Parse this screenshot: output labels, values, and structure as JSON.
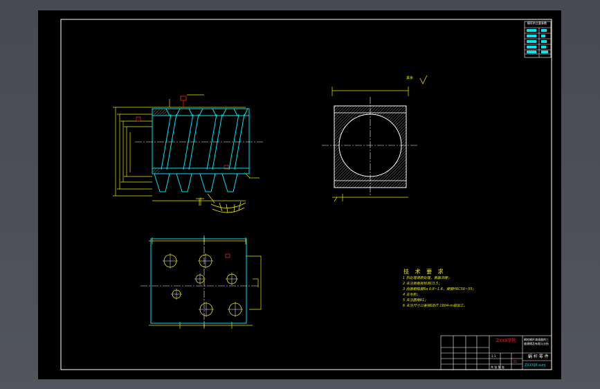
{
  "colors": {
    "background": "#000000",
    "frame": "#ffffff",
    "outline": "#00e5ee",
    "dimension": "#e8e800",
    "centerline": "#ffffff",
    "accent": "#ff2a2a",
    "hatch": "#bbbbbb"
  },
  "parameters_table": {
    "title": "蜗杆的主要参数",
    "rows": [
      "模数",
      "头数",
      "导程角",
      "旋向",
      "精度"
    ]
  },
  "roughness_note": "其余",
  "technical_requirements": {
    "title": "技 术 要 求",
    "items": [
      "1  热处理调质处理，表面淬硬；",
      "2  未注倒角按标准C0.5；",
      "3  齿面粗糙度Ra 0.8~1.6，硬度HRC50~55；",
      "4  去毛刺；",
      "5  未注圆角R1；",
      "6  未注尺寸公差按GB/T 1804-m级加工。"
    ]
  },
  "title_block": {
    "institution": "ZXXX学院",
    "drawing_title": "蜗轮蜗杆减速器的三维建模及有限元分析",
    "part_name": "蜗 杆 零 件",
    "drawing_number": "ZXXXJX-sunj",
    "mark": "31",
    "scale": "1:1",
    "sheet": "共 张 第 张"
  },
  "views": [
    "worm-front-view",
    "worm-end-view",
    "base-plate-view"
  ]
}
